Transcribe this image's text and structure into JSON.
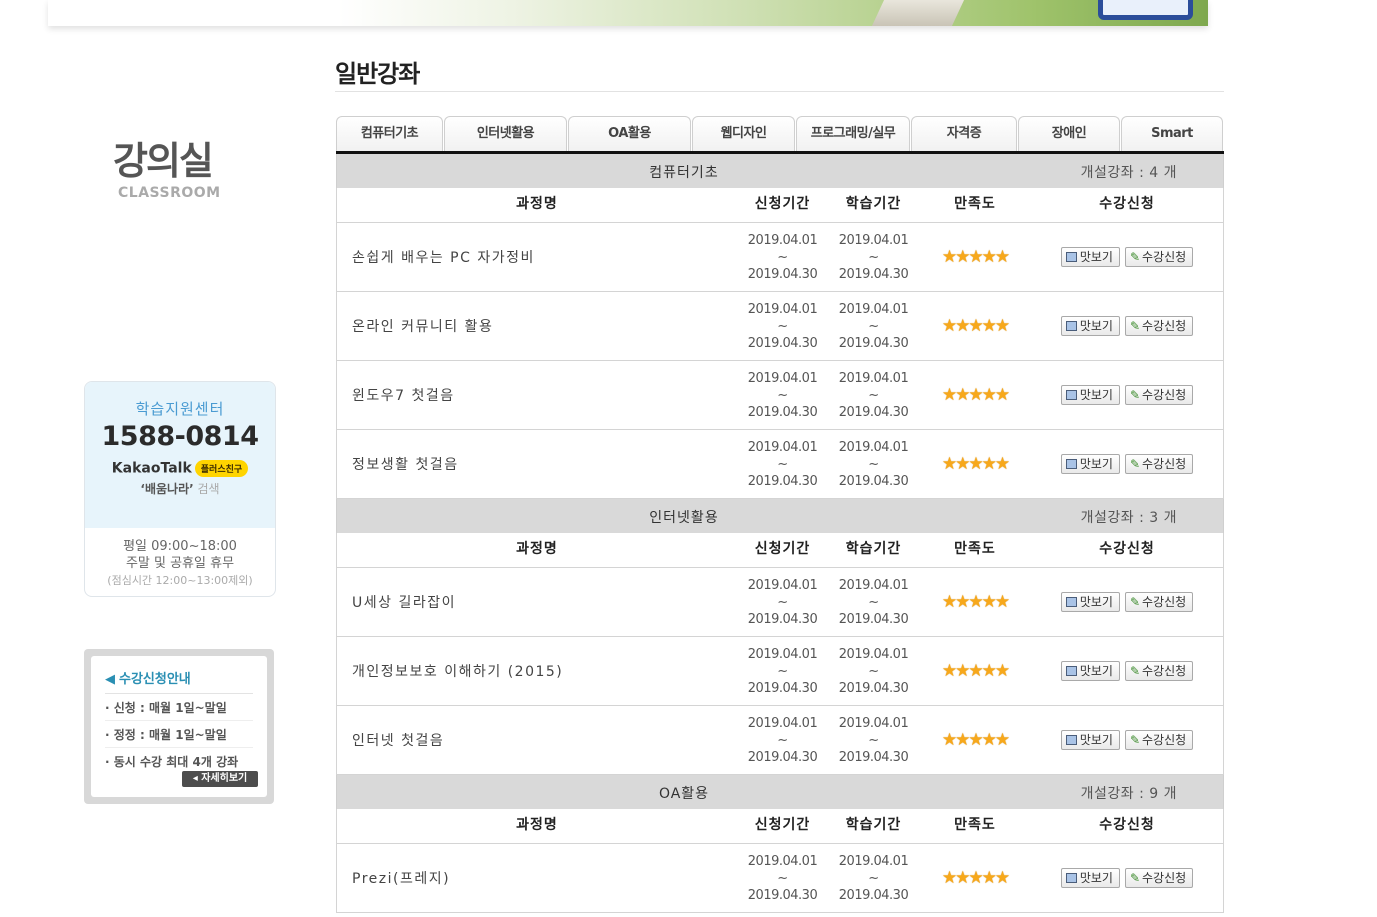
{
  "sidebar": {
    "title": "강의실",
    "subtitle": "CLASSROOM",
    "help": {
      "label": "학습지원센터",
      "phone": "1588-0814",
      "kakao_text": "KakaoTalk",
      "kakao_badge": "플러스친구",
      "search_term": "‘배움나라’",
      "search_word": "검색",
      "hours_weekday": "평일 09:00~18:00",
      "hours_weekend": "주말 및 공휴일 휴무",
      "hours_lunch": "(점심시간 12:00~13:00제외)"
    },
    "notice": {
      "title": "수강신청안내",
      "lines": [
        "· 신청 : 매월 1일~말일",
        "· 정정 : 매월 1일~말일",
        "· 동시 수강 최대 4개 강좌"
      ],
      "more": "◂ 자세히보기"
    }
  },
  "main": {
    "title": "일반강좌",
    "tabs": [
      "컴퓨터기초",
      "인터넷활용",
      "OA활용",
      "웹디자인",
      "프로그래밍/실무",
      "자격증",
      "장애인",
      "Smart"
    ],
    "columns": {
      "name": "과정명",
      "apply": "신청기간",
      "study": "학습기간",
      "satisfaction": "만족도",
      "action": "수강신청"
    },
    "stars": "★★★★★",
    "buttons": {
      "preview": "맛보기",
      "enroll": "수강신청"
    },
    "date_sep": "~",
    "groups": [
      {
        "name": "컴퓨터기초",
        "count": "개설강좌 : 4 개",
        "courses": [
          {
            "name": "손쉽게 배우는 PC 자가정비",
            "apply_start": "2019.04.01",
            "apply_end": "2019.04.30",
            "study_start": "2019.04.01",
            "study_end": "2019.04.30"
          },
          {
            "name": "온라인 커뮤니티 활용",
            "apply_start": "2019.04.01",
            "apply_end": "2019.04.30",
            "study_start": "2019.04.01",
            "study_end": "2019.04.30"
          },
          {
            "name": "윈도우7 첫걸음",
            "apply_start": "2019.04.01",
            "apply_end": "2019.04.30",
            "study_start": "2019.04.01",
            "study_end": "2019.04.30"
          },
          {
            "name": "정보생활 첫걸음",
            "apply_start": "2019.04.01",
            "apply_end": "2019.04.30",
            "study_start": "2019.04.01",
            "study_end": "2019.04.30"
          }
        ]
      },
      {
        "name": "인터넷활용",
        "count": "개설강좌 : 3 개",
        "courses": [
          {
            "name": "U세상 길라잡이",
            "apply_start": "2019.04.01",
            "apply_end": "2019.04.30",
            "study_start": "2019.04.01",
            "study_end": "2019.04.30"
          },
          {
            "name": "개인정보보호 이해하기 (2015)",
            "apply_start": "2019.04.01",
            "apply_end": "2019.04.30",
            "study_start": "2019.04.01",
            "study_end": "2019.04.30"
          },
          {
            "name": "인터넷 첫걸음",
            "apply_start": "2019.04.01",
            "apply_end": "2019.04.30",
            "study_start": "2019.04.01",
            "study_end": "2019.04.30"
          }
        ]
      },
      {
        "name": "OA활용",
        "count": "개설강좌 : 9 개",
        "courses": [
          {
            "name": "Prezi(프레지)",
            "apply_start": "2019.04.01",
            "apply_end": "2019.04.30",
            "study_start": "2019.04.01",
            "study_end": "2019.04.30"
          }
        ]
      }
    ]
  }
}
